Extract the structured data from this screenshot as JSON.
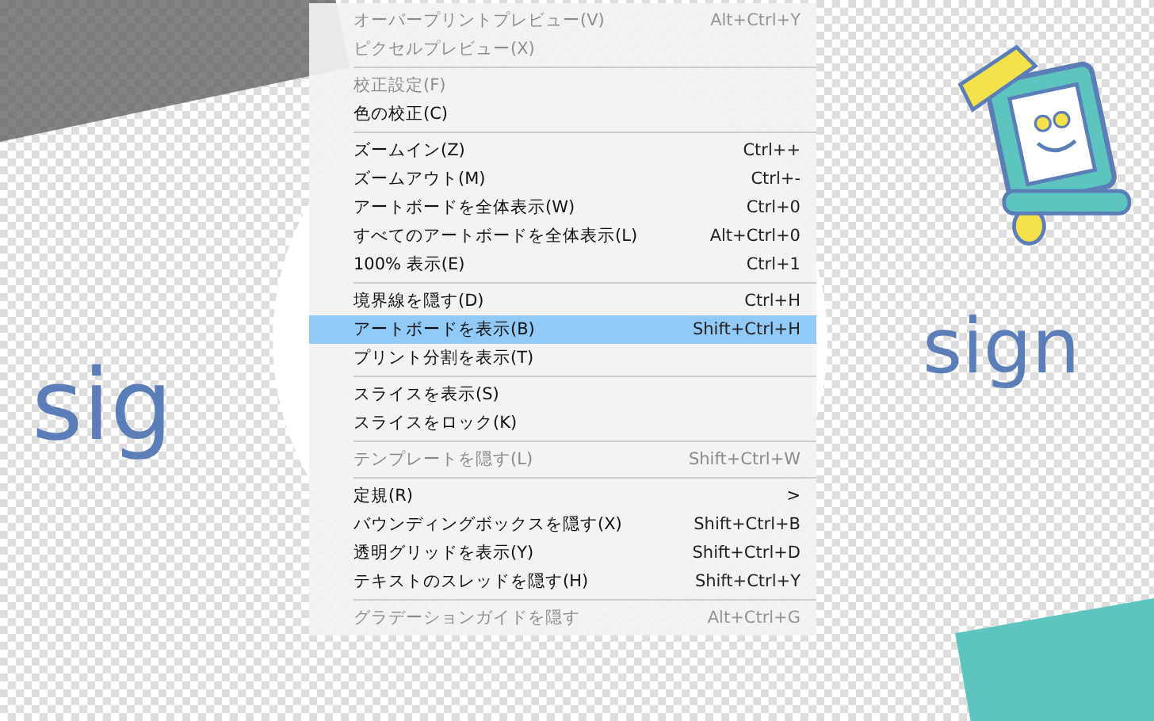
{
  "logo_texts": [
    {
      "text": "sig"
    },
    {
      "text": "sign"
    }
  ],
  "menu": {
    "groups": [
      [
        {
          "label": "オーバープリントプレビュー(V)",
          "shortcut": "Alt+Ctrl+Y",
          "selected": false,
          "disabled": false,
          "faded": true,
          "submenu": false
        },
        {
          "label": "ピクセルプレビュー(X)",
          "selected": false,
          "disabled": false,
          "faded": true,
          "submenu": false
        }
      ],
      [
        {
          "label": "校正設定(F)",
          "selected": false,
          "disabled": false,
          "faded": true,
          "submenu": false
        },
        {
          "label": "色の校正(C)",
          "selected": false,
          "disabled": false,
          "faded": false,
          "submenu": false
        }
      ],
      [
        {
          "label": "ズームイン(Z)",
          "shortcut": "Ctrl++",
          "selected": false,
          "disabled": false,
          "faded": false,
          "submenu": false
        },
        {
          "label": "ズームアウト(M)",
          "shortcut": "Ctrl+-",
          "selected": false,
          "disabled": false,
          "faded": false,
          "submenu": false
        },
        {
          "label": "アートボードを全体表示(W)",
          "shortcut": "Ctrl+0",
          "selected": false,
          "disabled": false,
          "faded": false,
          "submenu": false
        },
        {
          "label": "すべてのアートボードを全体表示(L)",
          "shortcut": "Alt+Ctrl+0",
          "selected": false,
          "disabled": false,
          "faded": false,
          "submenu": false
        },
        {
          "label": "100% 表示(E)",
          "shortcut": "Ctrl+1",
          "selected": false,
          "disabled": false,
          "faded": false,
          "submenu": false
        }
      ],
      [
        {
          "label": "境界線を隠す(D)",
          "shortcut": "Ctrl+H",
          "selected": false,
          "disabled": false,
          "faded": false,
          "submenu": false
        },
        {
          "label": "アートボードを表示(B)",
          "shortcut": "Shift+Ctrl+H",
          "selected": true,
          "disabled": false,
          "faded": false,
          "submenu": false
        },
        {
          "label": "プリント分割を表示(T)",
          "selected": false,
          "disabled": false,
          "faded": false,
          "submenu": false
        }
      ],
      [
        {
          "label": "スライスを表示(S)",
          "selected": false,
          "disabled": false,
          "faded": false,
          "submenu": false
        },
        {
          "label": "スライスをロック(K)",
          "selected": false,
          "disabled": false,
          "faded": false,
          "submenu": false
        }
      ],
      [
        {
          "label": "テンプレートを隠す(L)",
          "shortcut": "Shift+Ctrl+W",
          "selected": false,
          "disabled": true,
          "faded": false,
          "submenu": false
        }
      ],
      [
        {
          "label": "定規(R)",
          "selected": false,
          "disabled": false,
          "faded": false,
          "submenu": true
        },
        {
          "label": "バウンディングボックスを隠す(X)",
          "shortcut": "Shift+Ctrl+B",
          "selected": false,
          "disabled": false,
          "faded": false,
          "submenu": false
        },
        {
          "label": "透明グリッドを表示(Y)",
          "shortcut": "Shift+Ctrl+D",
          "selected": false,
          "disabled": false,
          "faded": false,
          "submenu": false
        },
        {
          "label": "テキストのスレッドを隠す(H)",
          "shortcut": "Shift+Ctrl+Y",
          "selected": false,
          "disabled": false,
          "faded": false,
          "submenu": false
        }
      ],
      [
        {
          "label": "グラデーションガイドを隠す",
          "shortcut": "Alt+Ctrl+G",
          "selected": false,
          "disabled": false,
          "faded": true,
          "submenu": false
        }
      ]
    ],
    "submenu_arrow": ">"
  }
}
